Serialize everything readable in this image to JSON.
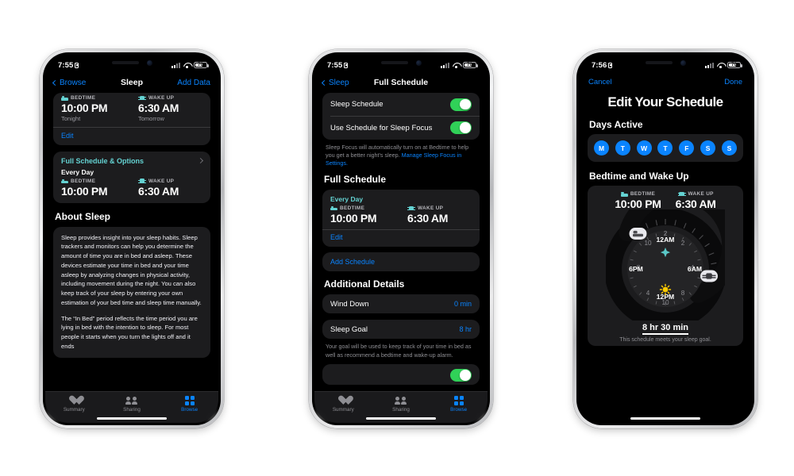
{
  "phone1": {
    "status": {
      "time": "7:55",
      "battery": "70",
      "lock_icon": "lock-icon",
      "wifi_icon": "wifi-icon",
      "signal_icon": "cellular-bars-icon"
    },
    "nav": {
      "back": "Browse",
      "title": "Sleep",
      "action": "Add Data"
    },
    "tonight_card": {
      "bedtime_label": "BEDTIME",
      "wakeup_label": "WAKE UP",
      "bedtime_value": "10:00 PM",
      "wakeup_value": "6:30 AM",
      "bedtime_sub": "Tonight",
      "wakeup_sub": "Tomorrow",
      "edit": "Edit"
    },
    "full_schedule_card": {
      "header": "Full Schedule & Options",
      "every_day": "Every Day",
      "bedtime_label": "BEDTIME",
      "wakeup_label": "WAKE UP",
      "bedtime_value": "10:00 PM",
      "wakeup_value": "6:30 AM"
    },
    "about": {
      "title": "About Sleep",
      "para1": "Sleep provides insight into your sleep habits. Sleep trackers and monitors can help you determine the amount of time you are in bed and asleep. These devices estimate your time in bed and your time asleep by analyzing changes in physical activity, including movement during the night. You can also keep track of your sleep by entering your own estimation of your bed time and sleep time manually.",
      "para2": "The “In Bed” period reflects the time period you are lying in bed with the intention to sleep. For most people it starts when you turn the lights off and it ends"
    },
    "tabs": [
      {
        "label": "Summary",
        "icon": "heart-icon",
        "active": false
      },
      {
        "label": "Sharing",
        "icon": "people-icon",
        "active": false
      },
      {
        "label": "Browse",
        "icon": "grid-icon",
        "active": true
      }
    ]
  },
  "phone2": {
    "status": {
      "time": "7:55",
      "battery": "70"
    },
    "nav": {
      "back": "Sleep",
      "title": "Full Schedule"
    },
    "toggles": [
      {
        "label": "Sleep Schedule",
        "on": true
      },
      {
        "label": "Use Schedule for Sleep Focus",
        "on": true
      }
    ],
    "focus_note_plain": "Sleep Focus will automatically turn on at Bedtime to help you get a better night's sleep. ",
    "focus_note_link": "Manage Sleep Focus in Settings.",
    "section_full_schedule": "Full Schedule",
    "schedule_card": {
      "every_day": "Every Day",
      "bedtime_label": "BEDTIME",
      "wakeup_label": "WAKE UP",
      "bedtime_value": "10:00 PM",
      "wakeup_value": "6:30 AM",
      "edit": "Edit"
    },
    "add_schedule": "Add Schedule",
    "section_additional": "Additional Details",
    "details": [
      {
        "label": "Wind Down",
        "value": "0 min"
      },
      {
        "label": "Sleep Goal",
        "value": "8 hr"
      }
    ],
    "goal_note": "Your goal will be used to keep track of your time in bed as well as recommend a bedtime and wake-up alarm.",
    "tabs": [
      {
        "label": "Summary",
        "icon": "heart-icon",
        "active": false
      },
      {
        "label": "Sharing",
        "icon": "people-icon",
        "active": false
      },
      {
        "label": "Browse",
        "icon": "grid-icon",
        "active": true
      }
    ]
  },
  "phone3": {
    "status": {
      "time": "7:56",
      "battery": "70"
    },
    "modal": {
      "cancel": "Cancel",
      "done": "Done",
      "title": "Edit Your Schedule"
    },
    "days_section": "Days Active",
    "days": [
      {
        "letter": "M",
        "active": true
      },
      {
        "letter": "T",
        "active": true
      },
      {
        "letter": "W",
        "active": true
      },
      {
        "letter": "T",
        "active": true
      },
      {
        "letter": "F",
        "active": true
      },
      {
        "letter": "S",
        "active": true
      },
      {
        "letter": "S",
        "active": true
      }
    ],
    "bedtime_section": "Bedtime and Wake Up",
    "bedtime_label": "BEDTIME",
    "wakeup_label": "WAKE UP",
    "bedtime_value": "10:00 PM",
    "wakeup_value": "6:30 AM",
    "clock": {
      "top_label": "12AM",
      "bottom_label": "12PM",
      "left_label": "6PM",
      "right_label": "6AM",
      "hours": [
        "2",
        "4",
        "8",
        "10",
        "2",
        "4",
        "8",
        "10"
      ],
      "moon_icon": "moon-star-icon",
      "sun_icon": "sun-icon",
      "bed_handle_icon": "bed-handle-icon",
      "alarm_handle_icon": "alarm-handle-icon"
    },
    "duration": "8 hr 30 min",
    "duration_note": "This schedule meets your sleep goal."
  },
  "colors": {
    "accent_blue": "#0a84ff",
    "accent_teal": "#64d2d2",
    "toggle_green": "#30d158",
    "card_bg": "#1c1c1e",
    "screen_bg": "#000000",
    "page_bg": "#ffffff"
  }
}
